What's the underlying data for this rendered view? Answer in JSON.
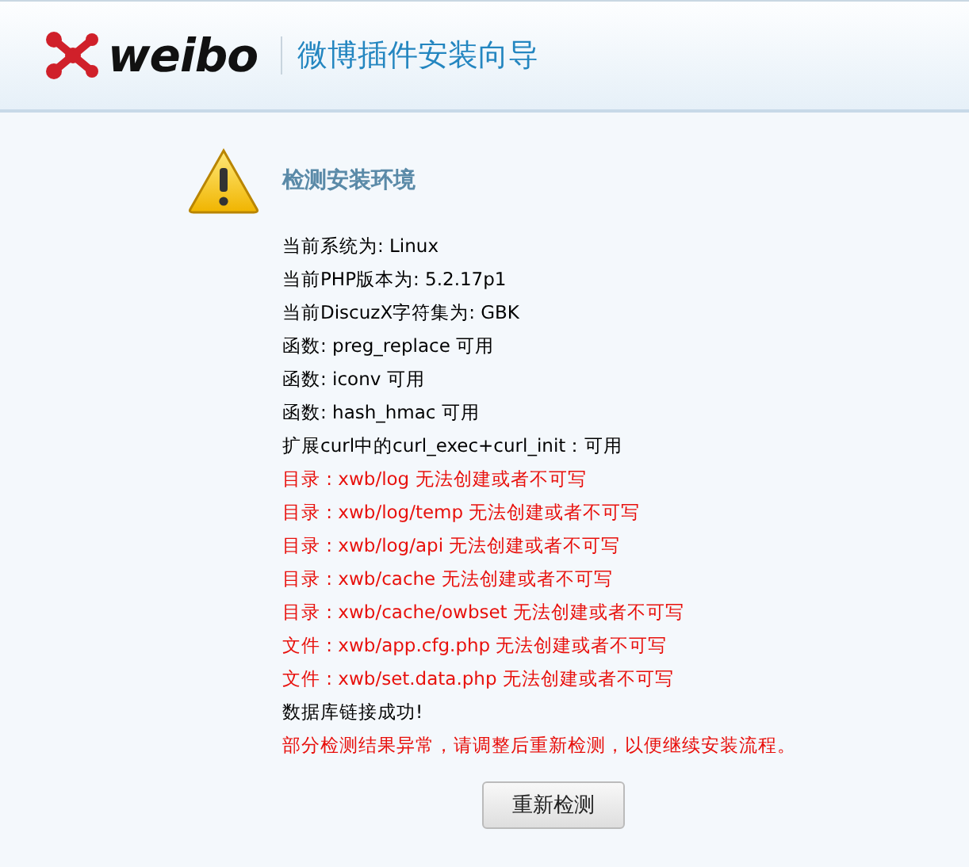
{
  "header": {
    "logo_text": "weibo",
    "title": "微博插件安装向导"
  },
  "section": {
    "heading": "检测安装环境"
  },
  "lines": [
    {
      "text": "当前系统为: Linux",
      "kind": "info"
    },
    {
      "text": "当前PHP版本为: 5.2.17p1",
      "kind": "info"
    },
    {
      "text": "当前DiscuzX字符集为: GBK",
      "kind": "info"
    },
    {
      "text": "函数: preg_replace 可用",
      "kind": "info"
    },
    {
      "text": "函数: iconv 可用",
      "kind": "info"
    },
    {
      "text": "函数: hash_hmac 可用",
      "kind": "info"
    },
    {
      "text": "扩展curl中的curl_exec+curl_init：可用",
      "kind": "info"
    },
    {
      "text": "目录 : xwb/log 无法创建或者不可写",
      "kind": "error"
    },
    {
      "text": "目录 : xwb/log/temp 无法创建或者不可写",
      "kind": "error"
    },
    {
      "text": "目录 : xwb/log/api 无法创建或者不可写",
      "kind": "error"
    },
    {
      "text": "目录 : xwb/cache 无法创建或者不可写",
      "kind": "error"
    },
    {
      "text": "目录 : xwb/cache/owbset 无法创建或者不可写",
      "kind": "error"
    },
    {
      "text": "文件 : xwb/app.cfg.php 无法创建或者不可写",
      "kind": "error"
    },
    {
      "text": "文件 : xwb/set.data.php 无法创建或者不可写",
      "kind": "error"
    },
    {
      "text": "数据库链接成功!",
      "kind": "info"
    },
    {
      "text": "部分检测结果异常，请调整后重新检测，以便继续安装流程。",
      "kind": "error"
    }
  ],
  "buttons": [
    "重新检测"
  ]
}
